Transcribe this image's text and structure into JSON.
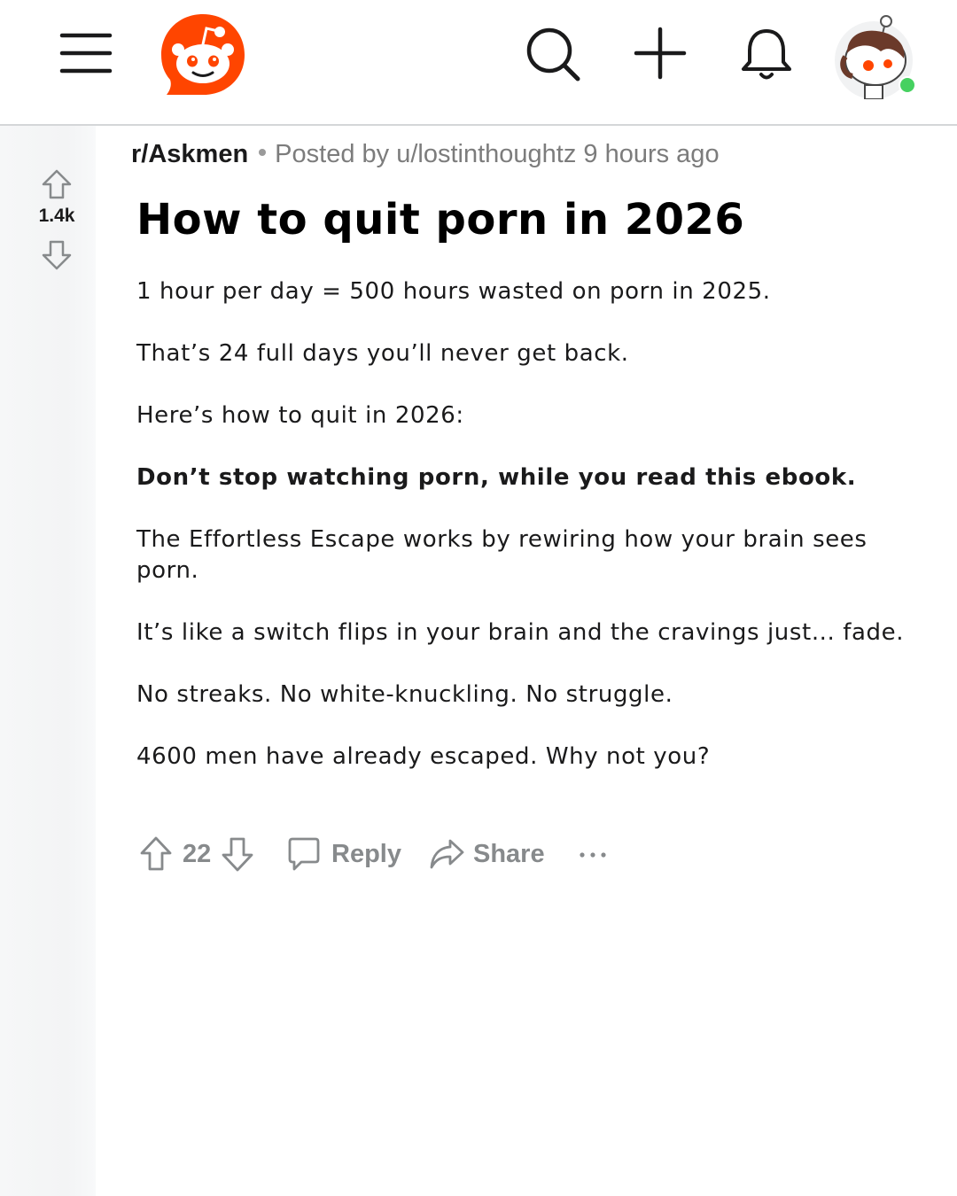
{
  "header": {
    "icons": [
      "menu-icon",
      "reddit-logo",
      "search-icon",
      "plus-icon",
      "bell-icon",
      "avatar"
    ],
    "brand_color": "#ff4500",
    "online_status_color": "#46d160"
  },
  "vote_rail": {
    "score": "1.4k"
  },
  "post": {
    "subreddit": "r/Askmen",
    "posted_by": "Posted by u/lostinthoughtz 9 hours ago",
    "title": "How to quit porn in 2026",
    "paragraphs": [
      "1 hour per day = 500 hours wasted on porn in 2025.",
      "That’s 24 full days you’ll never get back.",
      "Here’s how to quit in 2026:",
      "Don’t stop watching porn, while you read this ebook.",
      "The Effortless Escape works by rewiring how your brain sees porn.",
      "It’s like a switch flips in your brain and the cravings just... fade.",
      "No streaks. No white-knuckling. No struggle.",
      "4600 men have already escaped. Why not you?"
    ]
  },
  "actions": {
    "score": "22",
    "reply_label": "Reply",
    "share_label": "Share"
  }
}
